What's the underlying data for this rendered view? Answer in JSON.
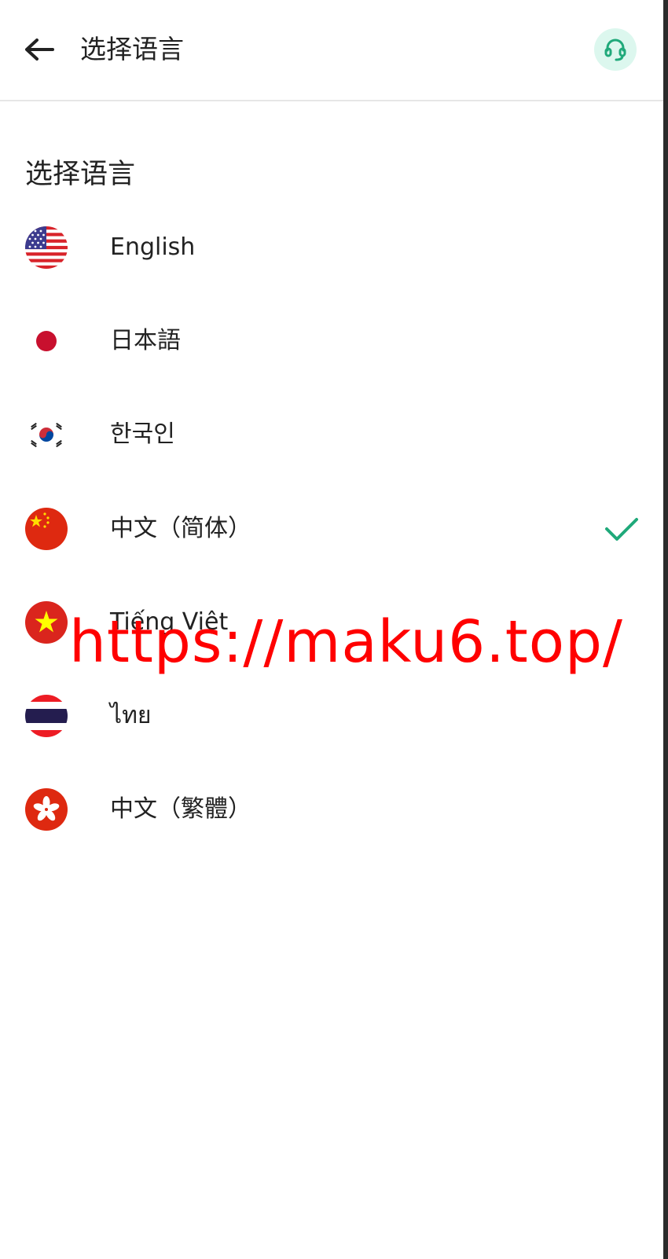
{
  "header": {
    "title": "选择语言",
    "back_icon": "arrow-left-icon",
    "support_icon": "headset-icon"
  },
  "section": {
    "title": "选择语言"
  },
  "languages": [
    {
      "label": "English",
      "flag": "us-flag-icon",
      "selected": false
    },
    {
      "label": "日本語",
      "flag": "jp-flag-icon",
      "selected": false
    },
    {
      "label": "한국인",
      "flag": "kr-flag-icon",
      "selected": false
    },
    {
      "label": "中文（简体）",
      "flag": "cn-flag-icon",
      "selected": true
    },
    {
      "label": "Tiếng Việt",
      "flag": "vn-flag-icon",
      "selected": false
    },
    {
      "label": "ไทย",
      "flag": "th-flag-icon",
      "selected": false
    },
    {
      "label": "中文（繁體）",
      "flag": "hk-flag-icon",
      "selected": false
    }
  ],
  "watermark": {
    "text": "https://maku6.top/"
  },
  "colors": {
    "accent": "#1fa97a",
    "support_bg": "#dcf7ee",
    "watermark": "#ff0000"
  }
}
